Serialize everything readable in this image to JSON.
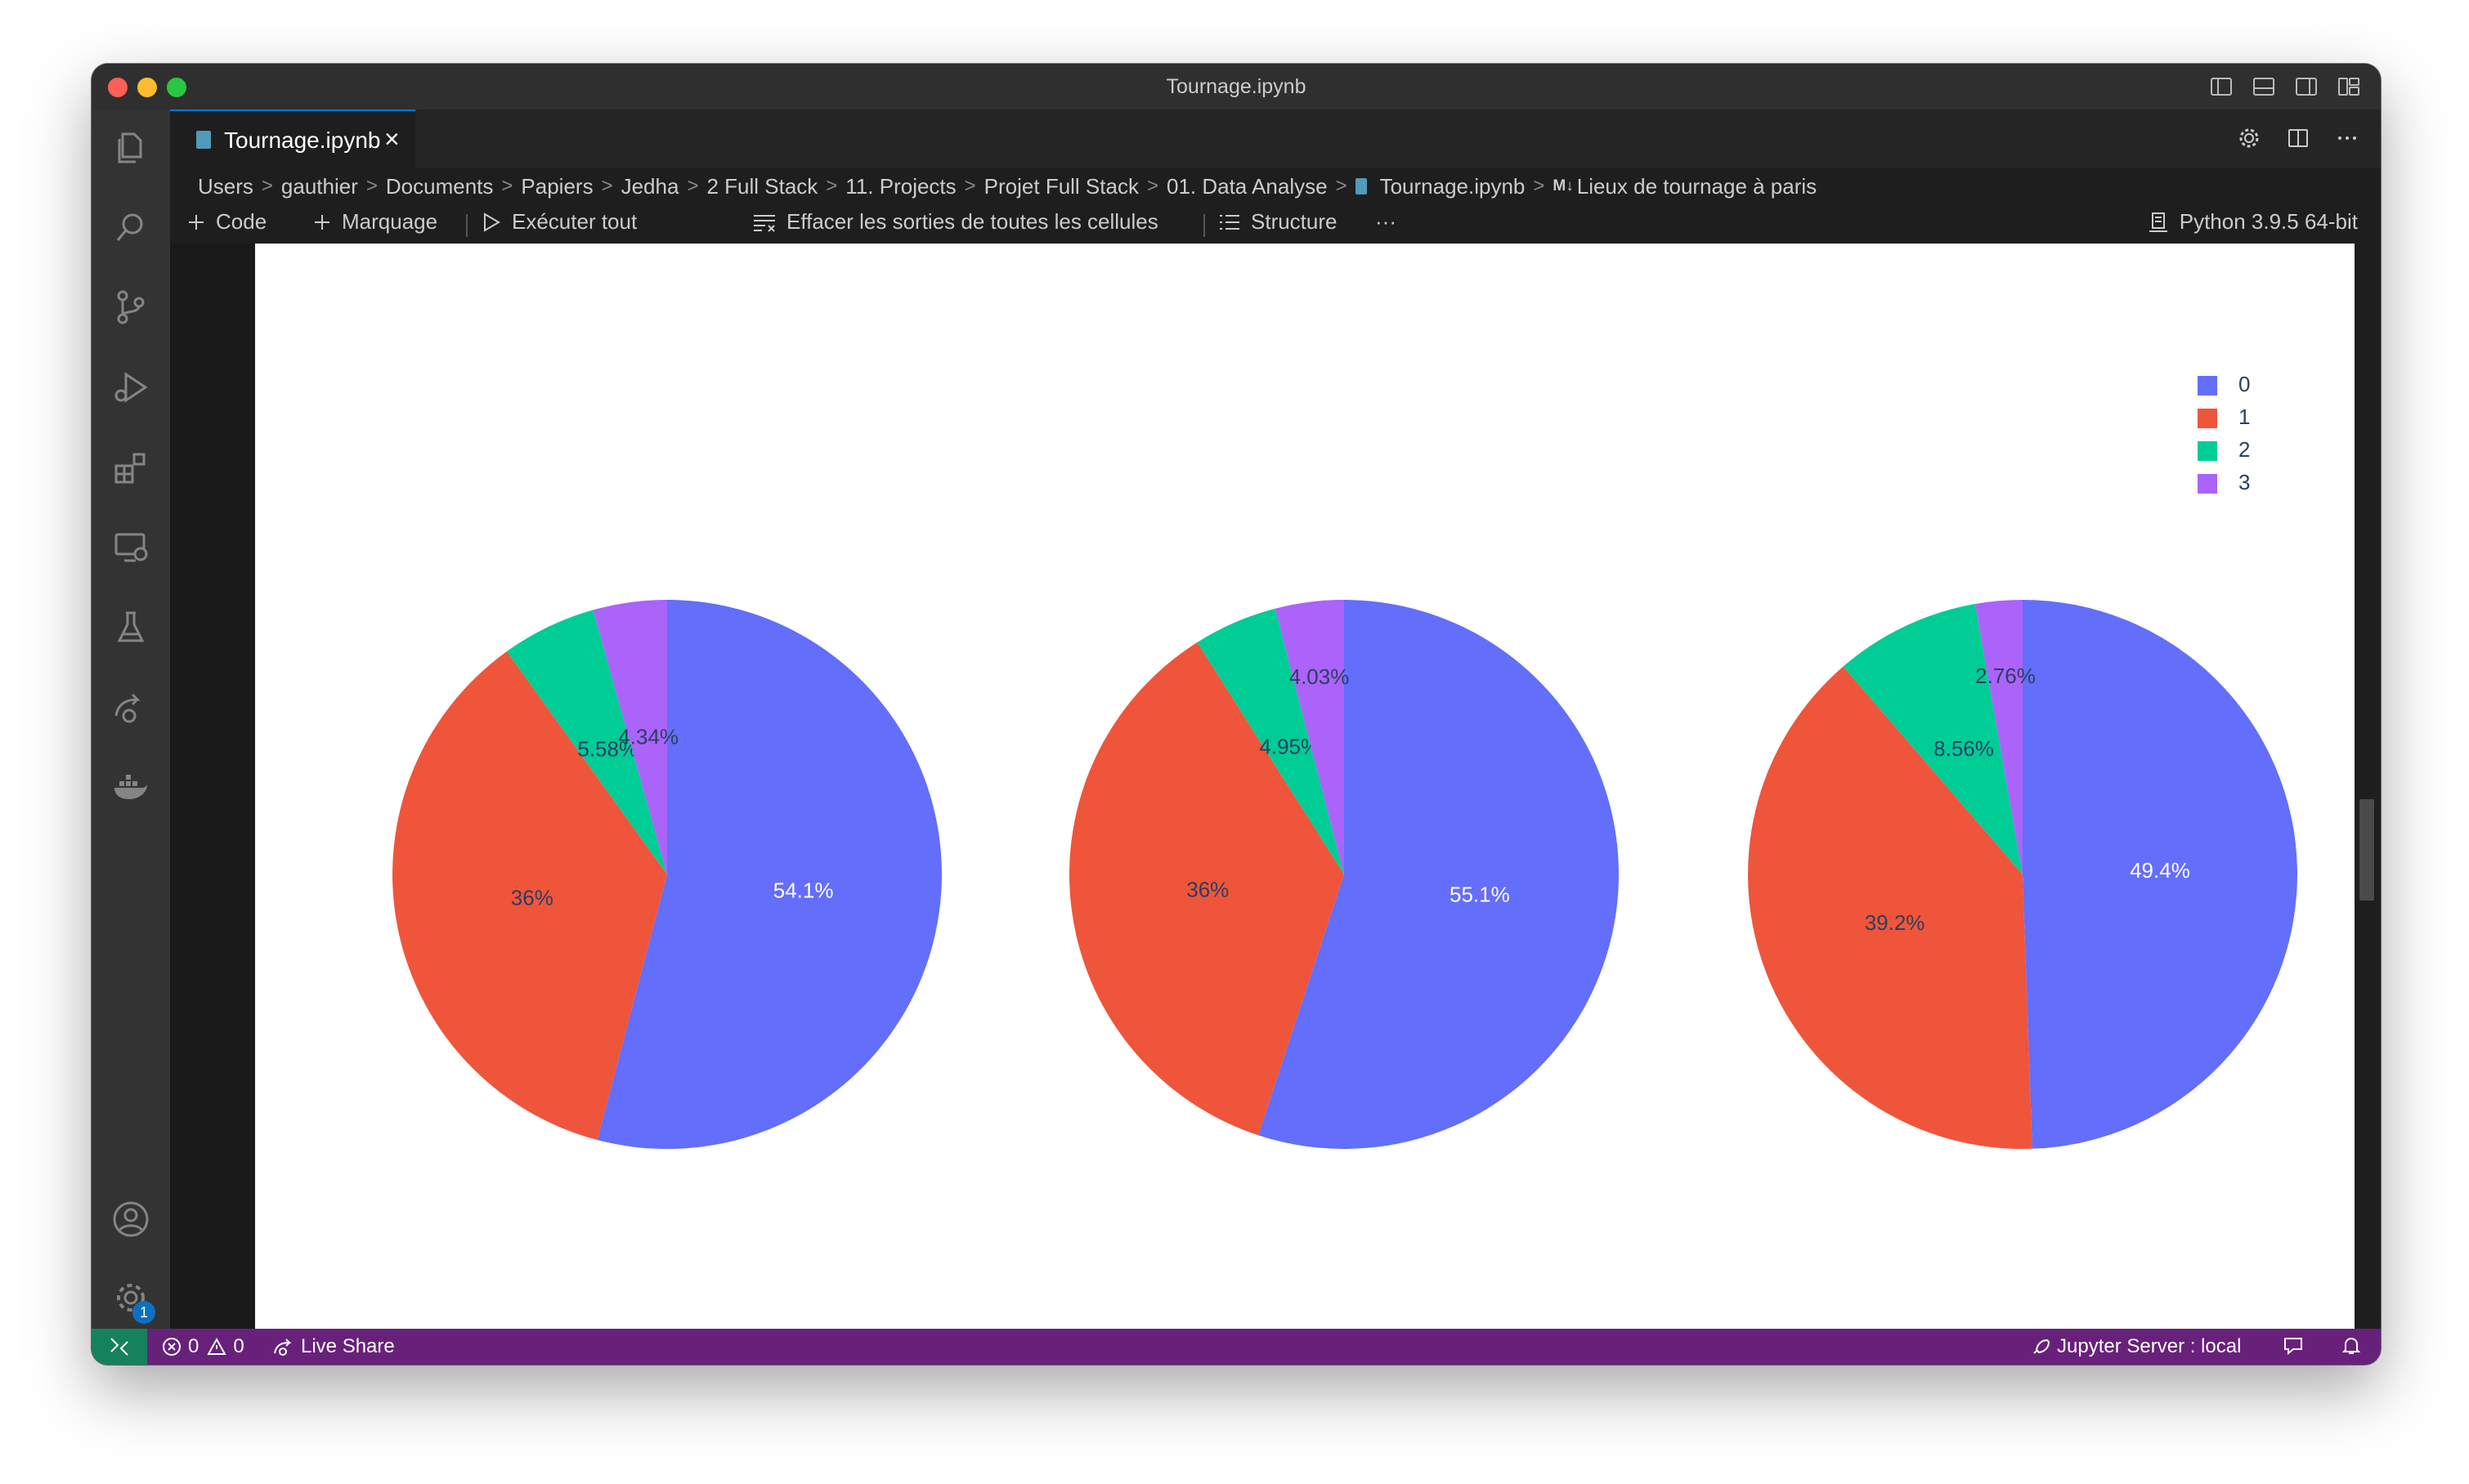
{
  "window": {
    "title": "Tournage.ipynb"
  },
  "tab": {
    "label": "Tournage.ipynb",
    "close_glyph": "×"
  },
  "breadcrumb": {
    "items": [
      "Users",
      "gauthier",
      "Documents",
      "Papiers",
      "Jedha",
      "2 Full Stack",
      "11. Projects",
      "Projet Full Stack",
      "01. Data Analyse"
    ],
    "file": "Tournage.ipynb",
    "md_marker": "M↓",
    "section": "Lieux de tournage à paris"
  },
  "toolbar": {
    "code_label": "Code",
    "markdown_label": "Marquage",
    "run_all_label": "Exécuter tout",
    "clear_label": "Effacer les sorties de toutes les cellules",
    "outline_label": "Structure",
    "more_glyph": "···",
    "kernel_label": "Python 3.9.5 64-bit"
  },
  "activity_bar": {
    "items": [
      "explorer-icon",
      "search-icon",
      "source-control-icon",
      "run-debug-icon",
      "extensions-icon",
      "remote-explorer-icon",
      "testing-icon",
      "live-share-icon",
      "docker-icon"
    ],
    "bottom": [
      "account-icon",
      "settings-gear-icon"
    ],
    "settings_badge": "1"
  },
  "statusbar": {
    "errors": "0",
    "warnings": "0",
    "live_share": "Live Share",
    "jupyter_server": "Jupyter Server : local"
  },
  "colors": {
    "slice0": "#636efa",
    "slice1": "#ef553b",
    "slice2": "#00cc96",
    "slice3": "#ab63fa",
    "statusbar": "#68217a",
    "remote": "#16825d"
  },
  "chart_data": [
    {
      "type": "pie",
      "labels": [
        "0",
        "1",
        "2",
        "3"
      ],
      "values": [
        54.1,
        36,
        5.58,
        4.34
      ],
      "text": [
        "54.1%",
        "36%",
        "5.58%",
        "4.34%"
      ]
    },
    {
      "type": "pie",
      "labels": [
        "0",
        "1",
        "2",
        "3"
      ],
      "values": [
        55.1,
        36,
        4.95,
        4.03
      ],
      "text": [
        "55.1%",
        "36%",
        "4.95%",
        "4.03%"
      ]
    },
    {
      "type": "pie",
      "labels": [
        "0",
        "1",
        "2",
        "3"
      ],
      "values": [
        49.4,
        39.2,
        8.56,
        2.76
      ],
      "text": [
        "49.4%",
        "39.2%",
        "8.56%",
        "2.76%"
      ],
      "legend": {
        "position": "top-right",
        "entries": [
          "0",
          "1",
          "2",
          "3"
        ]
      }
    }
  ]
}
